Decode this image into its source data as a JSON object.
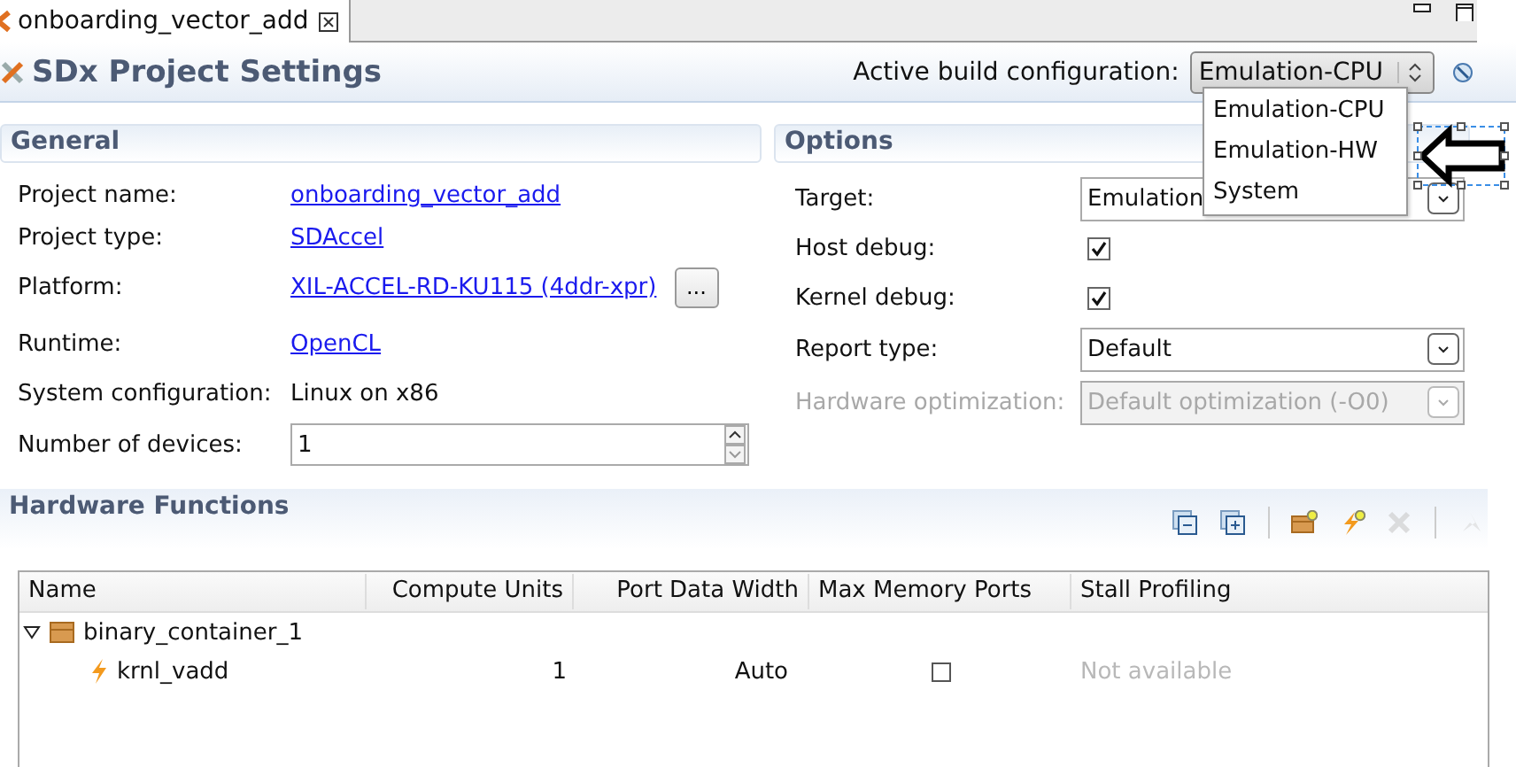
{
  "editor_tab": {
    "title": "onboarding_vector_add",
    "selected": true
  },
  "header": {
    "title": "SDx Project Settings",
    "config_label": "Active build configuration:",
    "config_value": "Emulation-CPU"
  },
  "config_menu": {
    "items": [
      {
        "label": "Emulation-CPU",
        "selected": false
      },
      {
        "label": "Emulation-HW",
        "selected": false
      },
      {
        "label": "System",
        "selected": false
      }
    ]
  },
  "general": {
    "title": "General",
    "fields": [
      {
        "label": "Project name:",
        "kind": "link",
        "value": "onboarding_vector_add"
      },
      {
        "label": "Project type:",
        "kind": "link",
        "value": "SDAccel"
      },
      {
        "label": "Platform:",
        "kind": "link",
        "value": "XIL-ACCEL-RD-KU115 (4ddr-xpr)",
        "button": "..."
      },
      {
        "label": "Runtime:",
        "kind": "link",
        "value": "OpenCL"
      },
      {
        "label": "System configuration:",
        "kind": "text",
        "value": "Linux on x86"
      },
      {
        "label": "Number of devices:",
        "kind": "spinner",
        "value": "1"
      }
    ]
  },
  "options": {
    "title": "Options",
    "fields": [
      {
        "label": "Target:",
        "kind": "select",
        "value": "Emulation",
        "disabled": false
      },
      {
        "label": "Host debug:",
        "kind": "checkbox",
        "checked": true,
        "disabled": false
      },
      {
        "label": "Kernel debug:",
        "kind": "checkbox",
        "checked": true,
        "disabled": false
      },
      {
        "label": "Report type:",
        "kind": "select",
        "value": "Default",
        "disabled": false
      },
      {
        "label": "Hardware optimization:",
        "kind": "select",
        "value": "Default optimization (-O0)",
        "disabled": true
      }
    ]
  },
  "hardware_functions": {
    "title": "Hardware Functions",
    "toolbar": [
      {
        "kind": "collapse",
        "disabled": false
      },
      {
        "kind": "expand",
        "disabled": false
      },
      {
        "kind": "separator"
      },
      {
        "kind": "add-container",
        "disabled": false
      },
      {
        "kind": "add-function",
        "disabled": false
      },
      {
        "kind": "delete",
        "disabled": true
      },
      {
        "kind": "separator"
      },
      {
        "kind": "profile",
        "disabled": true
      }
    ],
    "table": {
      "columns": [
        "Name",
        "Compute Units",
        "Port Data Width",
        "Max Memory Ports",
        "Stall Profiling"
      ],
      "rows": [
        {
          "kind": "container",
          "name": "binary_container_1",
          "expanded": true,
          "children": [
            {
              "kind": "function",
              "name": "krnl_vadd",
              "compute_units": "1",
              "port_data_width": "Auto",
              "max_memory_ports": false,
              "stall_profiling": "Not available",
              "stall_profiling_disabled": true
            }
          ]
        }
      ]
    }
  }
}
